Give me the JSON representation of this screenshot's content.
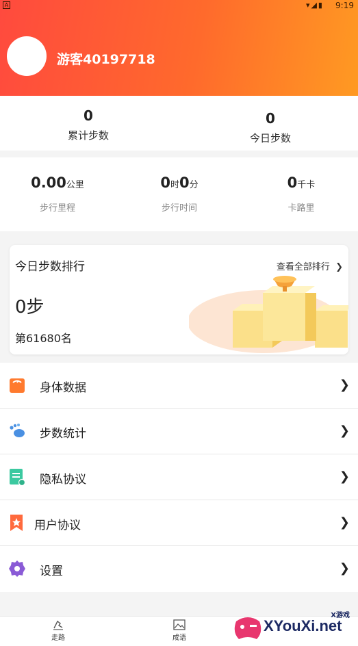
{
  "status_bar": {
    "time": "9:19",
    "left_icon": "A"
  },
  "profile": {
    "username": "游客40197718"
  },
  "summary": {
    "total_steps": {
      "value": "0",
      "label": "累计步数"
    },
    "today_steps": {
      "value": "0",
      "label": "今日步数"
    }
  },
  "metrics": {
    "distance": {
      "value": "0.00",
      "unit": "公里",
      "label": "步行里程"
    },
    "time": {
      "hours": "0",
      "hours_unit": "时",
      "minutes": "0",
      "minutes_unit": "分",
      "label": "步行时间"
    },
    "calories": {
      "value": "0",
      "unit": "千卡",
      "label": "卡路里"
    }
  },
  "ranking": {
    "title": "今日步数排行",
    "view_all": "查看全部排行",
    "steps": "0步",
    "position": "第61680名"
  },
  "menu": [
    {
      "label": "身体数据",
      "icon": "scale-icon",
      "color": "#ff7a2e"
    },
    {
      "label": "步数统计",
      "icon": "footprint-icon",
      "color": "#4a90e2"
    },
    {
      "label": "隐私协议",
      "icon": "document-icon",
      "color": "#3bc9a0"
    },
    {
      "label": "用户协议",
      "icon": "bookmark-star-icon",
      "color": "#ff6a3d"
    },
    {
      "label": "设置",
      "icon": "gear-icon",
      "color": "#8a5bd6"
    }
  ],
  "bottom_nav": [
    {
      "label": "走路",
      "icon": "walk-icon"
    },
    {
      "label": "成语",
      "icon": "image-icon"
    }
  ],
  "watermark": {
    "brand": "XYouXi.net",
    "small": "X游戏"
  },
  "colors": {
    "header_start": "#ff4a3e",
    "header_end": "#ff9a22",
    "accent": "#ff6a2c"
  }
}
